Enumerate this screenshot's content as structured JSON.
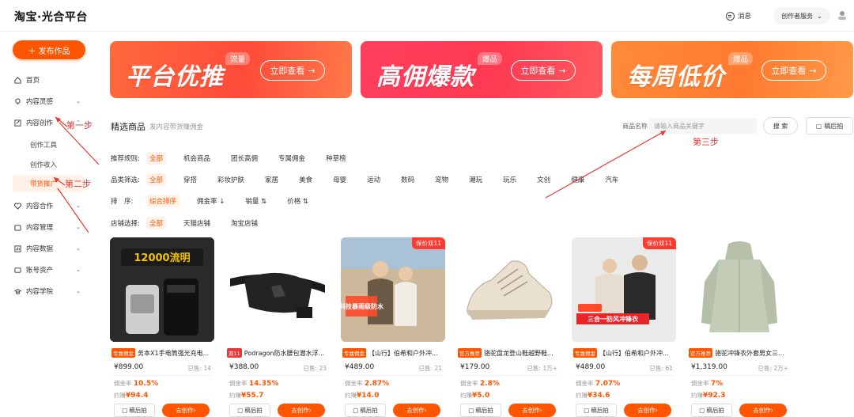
{
  "header": {
    "logo": "淘宝·光合平台",
    "message_label": "消息",
    "service_label": "创作者服务"
  },
  "sidebar": {
    "publish_label": "发布作品",
    "items": [
      {
        "label": "首页"
      },
      {
        "label": "内容灵感"
      },
      {
        "label": "内容创作"
      },
      {
        "label": "内容合作"
      },
      {
        "label": "内容管理"
      },
      {
        "label": "内容数据"
      },
      {
        "label": "账号资产"
      },
      {
        "label": "内容学院"
      }
    ],
    "sub_items": [
      {
        "label": "创作工具"
      },
      {
        "label": "创作收入"
      },
      {
        "label": "带货推广"
      }
    ]
  },
  "banners": [
    {
      "title": "平台优推",
      "tag": "流量",
      "cta": "立即查看"
    },
    {
      "title": "高佣爆款",
      "tag": "爆品",
      "cta": "立即查看"
    },
    {
      "title": "每周低价",
      "tag": "爆品",
      "cta": "立即查看"
    }
  ],
  "section": {
    "title": "精选商品",
    "subtitle": "发内容带货赚佣金",
    "search_label": "商品名称",
    "search_placeholder": "请输入商品关键字",
    "search_button": "搜 索",
    "draft_button": "稿后拍"
  },
  "filters": {
    "rule": {
      "label": "推荐规则:",
      "options": [
        "全部",
        "机会商品",
        "团长高佣",
        "专属佣金",
        "种草榜"
      ]
    },
    "category": {
      "label": "品类筛选:",
      "options": [
        "全部",
        "穿搭",
        "彩妆护肤",
        "家居",
        "美食",
        "母婴",
        "运动",
        "数码",
        "宠物",
        "潮玩",
        "玩乐",
        "文创",
        "健康",
        "汽车"
      ]
    },
    "sort": {
      "label": "排　序:",
      "options": [
        "综合排序",
        "佣金率",
        "销量",
        "价格"
      ]
    },
    "shop": {
      "label": "店铺选择:",
      "options": [
        "全部",
        "天猫店铺",
        "淘宝店铺"
      ]
    }
  },
  "products": [
    {
      "tag": "专属佣金",
      "name": "务本X1手电筒强光充电...",
      "price": "¥899.00",
      "sold": "已售: 14",
      "rate_label": "佣金率",
      "rate": "10.5%",
      "earn_label": "约赚",
      "earn": "¥94.4",
      "draft": "稿后拍",
      "create": "去创作",
      "badge": "",
      "img_text": "12000流明"
    },
    {
      "tag": "双11",
      "name": "Podragon防水腰包潜水浮...",
      "price": "¥388.00",
      "sold": "已售: 23",
      "rate_label": "佣金率",
      "rate": "14.35%",
      "earn_label": "约赚",
      "earn": "¥55.7",
      "draft": "稿后拍",
      "create": "去创作",
      "badge": "",
      "img_text": ""
    },
    {
      "tag": "专属佣金",
      "name": "【山行】伯希和户外冲...",
      "price": "¥489.00",
      "sold": "已售: 21",
      "rate_label": "佣金率",
      "rate": "2.87%",
      "earn_label": "约赚",
      "earn": "¥14.0",
      "draft": "稿后拍",
      "create": "去创作",
      "badge": "保价双11",
      "img_text": "科技暴雨级防水"
    },
    {
      "tag": "官方推荐",
      "name": "骆驼盘龙登山鞋越野鞋...",
      "price": "¥179.00",
      "sold": "已售: 1万+",
      "rate_label": "佣金率",
      "rate": "2.8%",
      "earn_label": "约赚",
      "earn": "¥5.0",
      "draft": "稿后拍",
      "create": "去创作",
      "badge": "",
      "img_text": ""
    },
    {
      "tag": "专属佣金",
      "name": "【山行】伯希和户外冲...",
      "price": "¥489.00",
      "sold": "已售: 61",
      "rate_label": "佣金率",
      "rate": "7.07%",
      "earn_label": "约赚",
      "earn": "¥34.6",
      "draft": "稿后拍",
      "create": "去创作",
      "badge": "保价双11",
      "img_text": "三合一防风冲锋衣"
    },
    {
      "tag": "官方推荐",
      "name": "骆驼冲锋衣外套男女三...",
      "price": "¥1,319.00",
      "sold": "已售: 2万+",
      "rate_label": "佣金率",
      "rate": "7%",
      "earn_label": "约赚",
      "earn": "¥92.3",
      "draft": "稿后拍",
      "create": "去创作",
      "badge": "",
      "img_text": ""
    }
  ],
  "annotations": {
    "step1": "第一步",
    "step2": "第二步",
    "step3": "第三步"
  },
  "colors": {
    "accent": "#ff5500",
    "annotation": "#e53935"
  }
}
